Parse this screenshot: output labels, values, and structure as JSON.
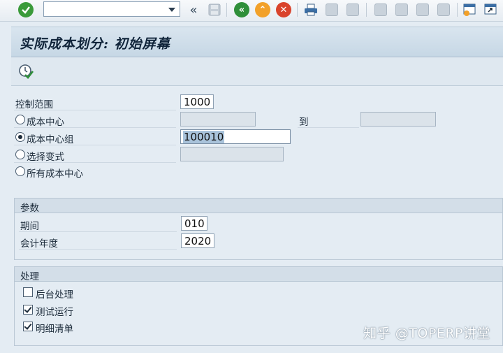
{
  "toolbar": {
    "command_field_value": "",
    "icons": [
      "enter-icon",
      "command-dropdown-icon",
      "collapse-icon",
      "save-icon",
      "back-icon",
      "exit-icon",
      "cancel-icon",
      "print-icon",
      "find-icon",
      "find-next-icon",
      "first-page-icon",
      "previous-page-icon",
      "next-page-icon",
      "last-page-icon",
      "new-session-icon",
      "shortcut-icon"
    ]
  },
  "title": "实际成本划分: 初始屏幕",
  "form": {
    "controlling_area_label": "控制范围",
    "controlling_area_value": "1000",
    "cost_center_label": "成本中心",
    "to_label": "到",
    "cost_center_group_label": "成本中心组",
    "cost_center_group_value": "100010",
    "selection_variant_label": "选择变式",
    "all_cost_centers_label": "所有成本中心"
  },
  "params": {
    "title": "参数",
    "period_label": "期间",
    "period_value": "010",
    "fiscal_year_label": "会计年度",
    "fiscal_year_value": "2020"
  },
  "processing": {
    "title": "处理",
    "background_label": "后台处理",
    "background_checked": false,
    "test_run_label": "测试运行",
    "test_run_checked": true,
    "detail_list_label": "明细清单",
    "detail_list_checked": true
  },
  "watermark": "知乎 @TOPERP讲堂",
  "colors": {
    "enter_green": "#3a9a3a",
    "back_green": "#2f8f3a",
    "exit_orange": "#f2a12a",
    "cancel_red": "#d9432c"
  }
}
